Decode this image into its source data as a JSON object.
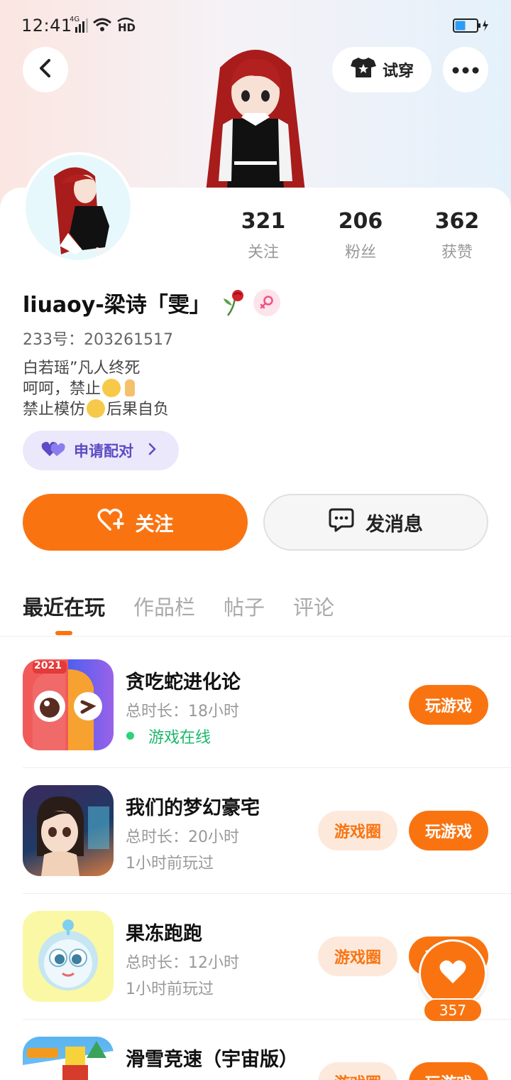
{
  "status_bar": {
    "time": "12:41",
    "network": "4G",
    "hd": "HD"
  },
  "header": {
    "tryon_label": "试穿"
  },
  "stats": [
    {
      "value": "321",
      "label": "关注"
    },
    {
      "value": "206",
      "label": "粉丝"
    },
    {
      "value": "362",
      "label": "获赞"
    }
  ],
  "profile": {
    "username": "liuaoy-梁诗「雯」",
    "id_text": "233号：203261517",
    "bio_lines": [
      "白若瑶”凡人终死",
      "呵呵，禁止",
      "禁止模仿",
      "后果自负"
    ],
    "pair_label": "申请配对"
  },
  "actions": {
    "follow_label": "关注",
    "message_label": "发消息"
  },
  "tabs": [
    "最近在玩",
    "作品栏",
    "帖子",
    "评论"
  ],
  "games": [
    {
      "title": "贪吃蛇进化论",
      "time": "总时长：18小时",
      "status": "游戏在线",
      "online": true,
      "icon_badge": "2021",
      "play": "玩游戏"
    },
    {
      "title": "我们的梦幻豪宅",
      "time": "总时长：20小时",
      "status": "1小时前玩过",
      "circle": "游戏圈",
      "play": "玩游戏"
    },
    {
      "title": "果冻跑跑",
      "time": "总时长：12小时",
      "status": "1小时前玩过",
      "circle": "游戏圈",
      "play": "玩游戏"
    },
    {
      "title": "滑雪竞速（宇宙版）",
      "circle": "游戏圈",
      "play": "玩游戏"
    }
  ],
  "like": {
    "count": "357"
  },
  "colors": {
    "accent": "#f97411",
    "pair_bg": "#ebe8fb",
    "online": "#1cb86b"
  }
}
